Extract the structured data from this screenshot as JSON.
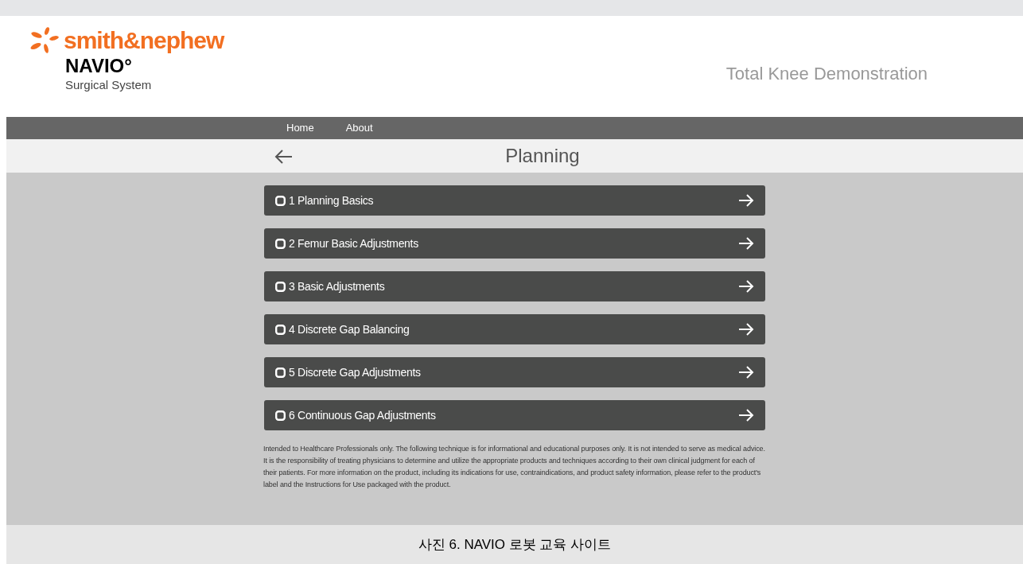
{
  "logo": {
    "brand": "smith&nephew",
    "product": "NAVIO°",
    "subtitle": "Surgical System"
  },
  "header_title": "Total Knee Demonstration",
  "nav": [
    {
      "label": "Home"
    },
    {
      "label": "About"
    }
  ],
  "page_title": "Planning",
  "modules": [
    {
      "label": "1 Planning Basics",
      "checked": false
    },
    {
      "label": "2 Femur Basic Adjustments",
      "checked": false
    },
    {
      "label": "3 Basic Adjustments",
      "checked": false
    },
    {
      "label": "4 Discrete Gap Balancing",
      "checked": false
    },
    {
      "label": "5 Discrete Gap Adjustments",
      "checked": false
    },
    {
      "label": "6 Continuous Gap Adjustments",
      "checked": false
    }
  ],
  "disclaimer": "Intended to Healthcare Professionals only. The following technique is for informational and educational purposes only. It is not intended to serve as medical advice. It is the responsibility of treating physicians to determine and utilize the appropriate products and techniques according to their own clinical judgment for each of their patients. For more information on the product, including its indications for use, contraindications, and product safety information, please refer to the product's label and the Instructions for Use packaged with the product.",
  "caption": "사진 6. NAVIO 로봇 교육 사이트"
}
